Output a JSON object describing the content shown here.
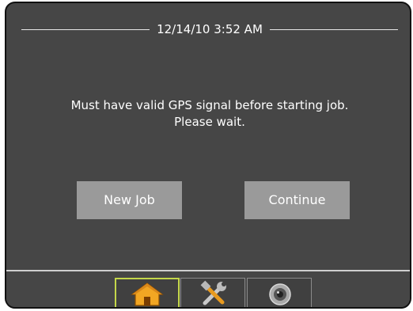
{
  "header": {
    "datetime": "12/14/10 3:52 AM"
  },
  "message": {
    "line1": "Must have valid GPS signal before starting job.",
    "line2": "Please wait."
  },
  "buttons": {
    "new_job": "New Job",
    "continue": "Continue"
  },
  "tabs": [
    {
      "name": "home",
      "icon": "home-icon",
      "selected": true
    },
    {
      "name": "tools",
      "icon": "tools-icon",
      "selected": false
    },
    {
      "name": "camera",
      "icon": "camera-icon",
      "selected": false
    }
  ],
  "colors": {
    "background": "#464646",
    "button": "#9a9a9a",
    "selected_tab_border": "#c4d74a",
    "home_icon": "#f0a41c"
  }
}
